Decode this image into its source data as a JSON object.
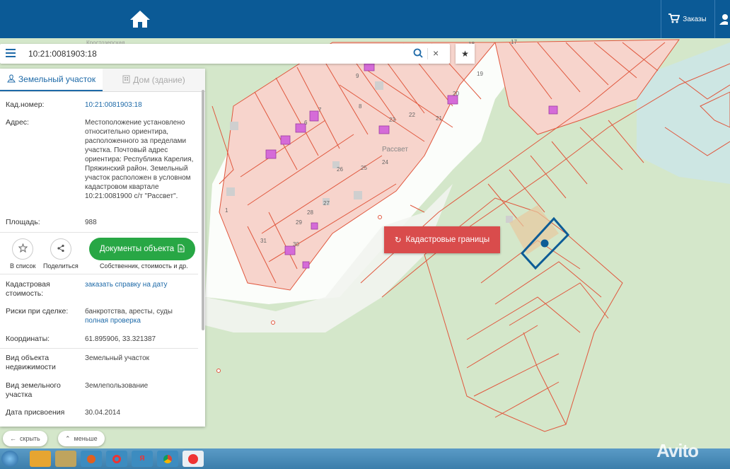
{
  "toolbar": {
    "orders_label": "Заказы"
  },
  "search": {
    "value": "10:21:0081903:18",
    "clear_label": "×",
    "star_label": "★"
  },
  "panel": {
    "tab_land": "Земельный участок",
    "tab_house": "Дом (здание)",
    "fields": {
      "cad_number_label": "Кад.номер:",
      "cad_number_value": "10:21:0081903:18",
      "address_label": "Адрес:",
      "address_value": "Местоположение установлено относительно ориентира, расположенного за пределами участка. Почтовый адрес ориентира: Республика Карелия, Пряжинский район. Земельный участок расположен в условном кадастровом квартале 10:21:0081900 с/т \"Рассвет\".",
      "area_label": "Площадь:",
      "area_value": "988",
      "cost_label": "Кадастровая стоимость:",
      "cost_value": "заказать справку на дату",
      "risks_label": "Риски при сделке:",
      "risks_value": "банкротства, аресты, суды",
      "risks_link": "полная проверка",
      "coords_label": "Координаты:",
      "coords_value": "61.895906, 33.321387",
      "type_label": "Вид объекта недвижимости",
      "type_value": "Земельный участок",
      "use_label": "Вид земельного участка",
      "use_value": "Землепользование",
      "date_label": "Дата присвоения",
      "date_value": "30.04.2014"
    },
    "actions": {
      "to_list": "В список",
      "share": "Поделиться",
      "docs_button": "Документы объекта",
      "docs_sub": "Собственник, стоимость и др."
    }
  },
  "bottom": {
    "hide": "скрыть",
    "less": "меньше"
  },
  "map": {
    "cadastral_button": "Кадастровые границы",
    "labels": {
      "rassvet": "Рассвет",
      "street": "Кростозерская"
    },
    "plot_numbers": [
      "9",
      "8",
      "7",
      "6",
      "22",
      "21",
      "20",
      "25",
      "24",
      "26",
      "27",
      "28",
      "29",
      "30",
      "31",
      "1",
      "17",
      "18",
      "19",
      "23"
    ]
  },
  "watermark": "Avito",
  "colors": {
    "topbar": "#0b5a96",
    "accent": "#1e6aa8",
    "green": "#28a745",
    "red_btn": "#d94c4c",
    "parcel_line": "#e0573d",
    "selected": "#0d5c96"
  }
}
